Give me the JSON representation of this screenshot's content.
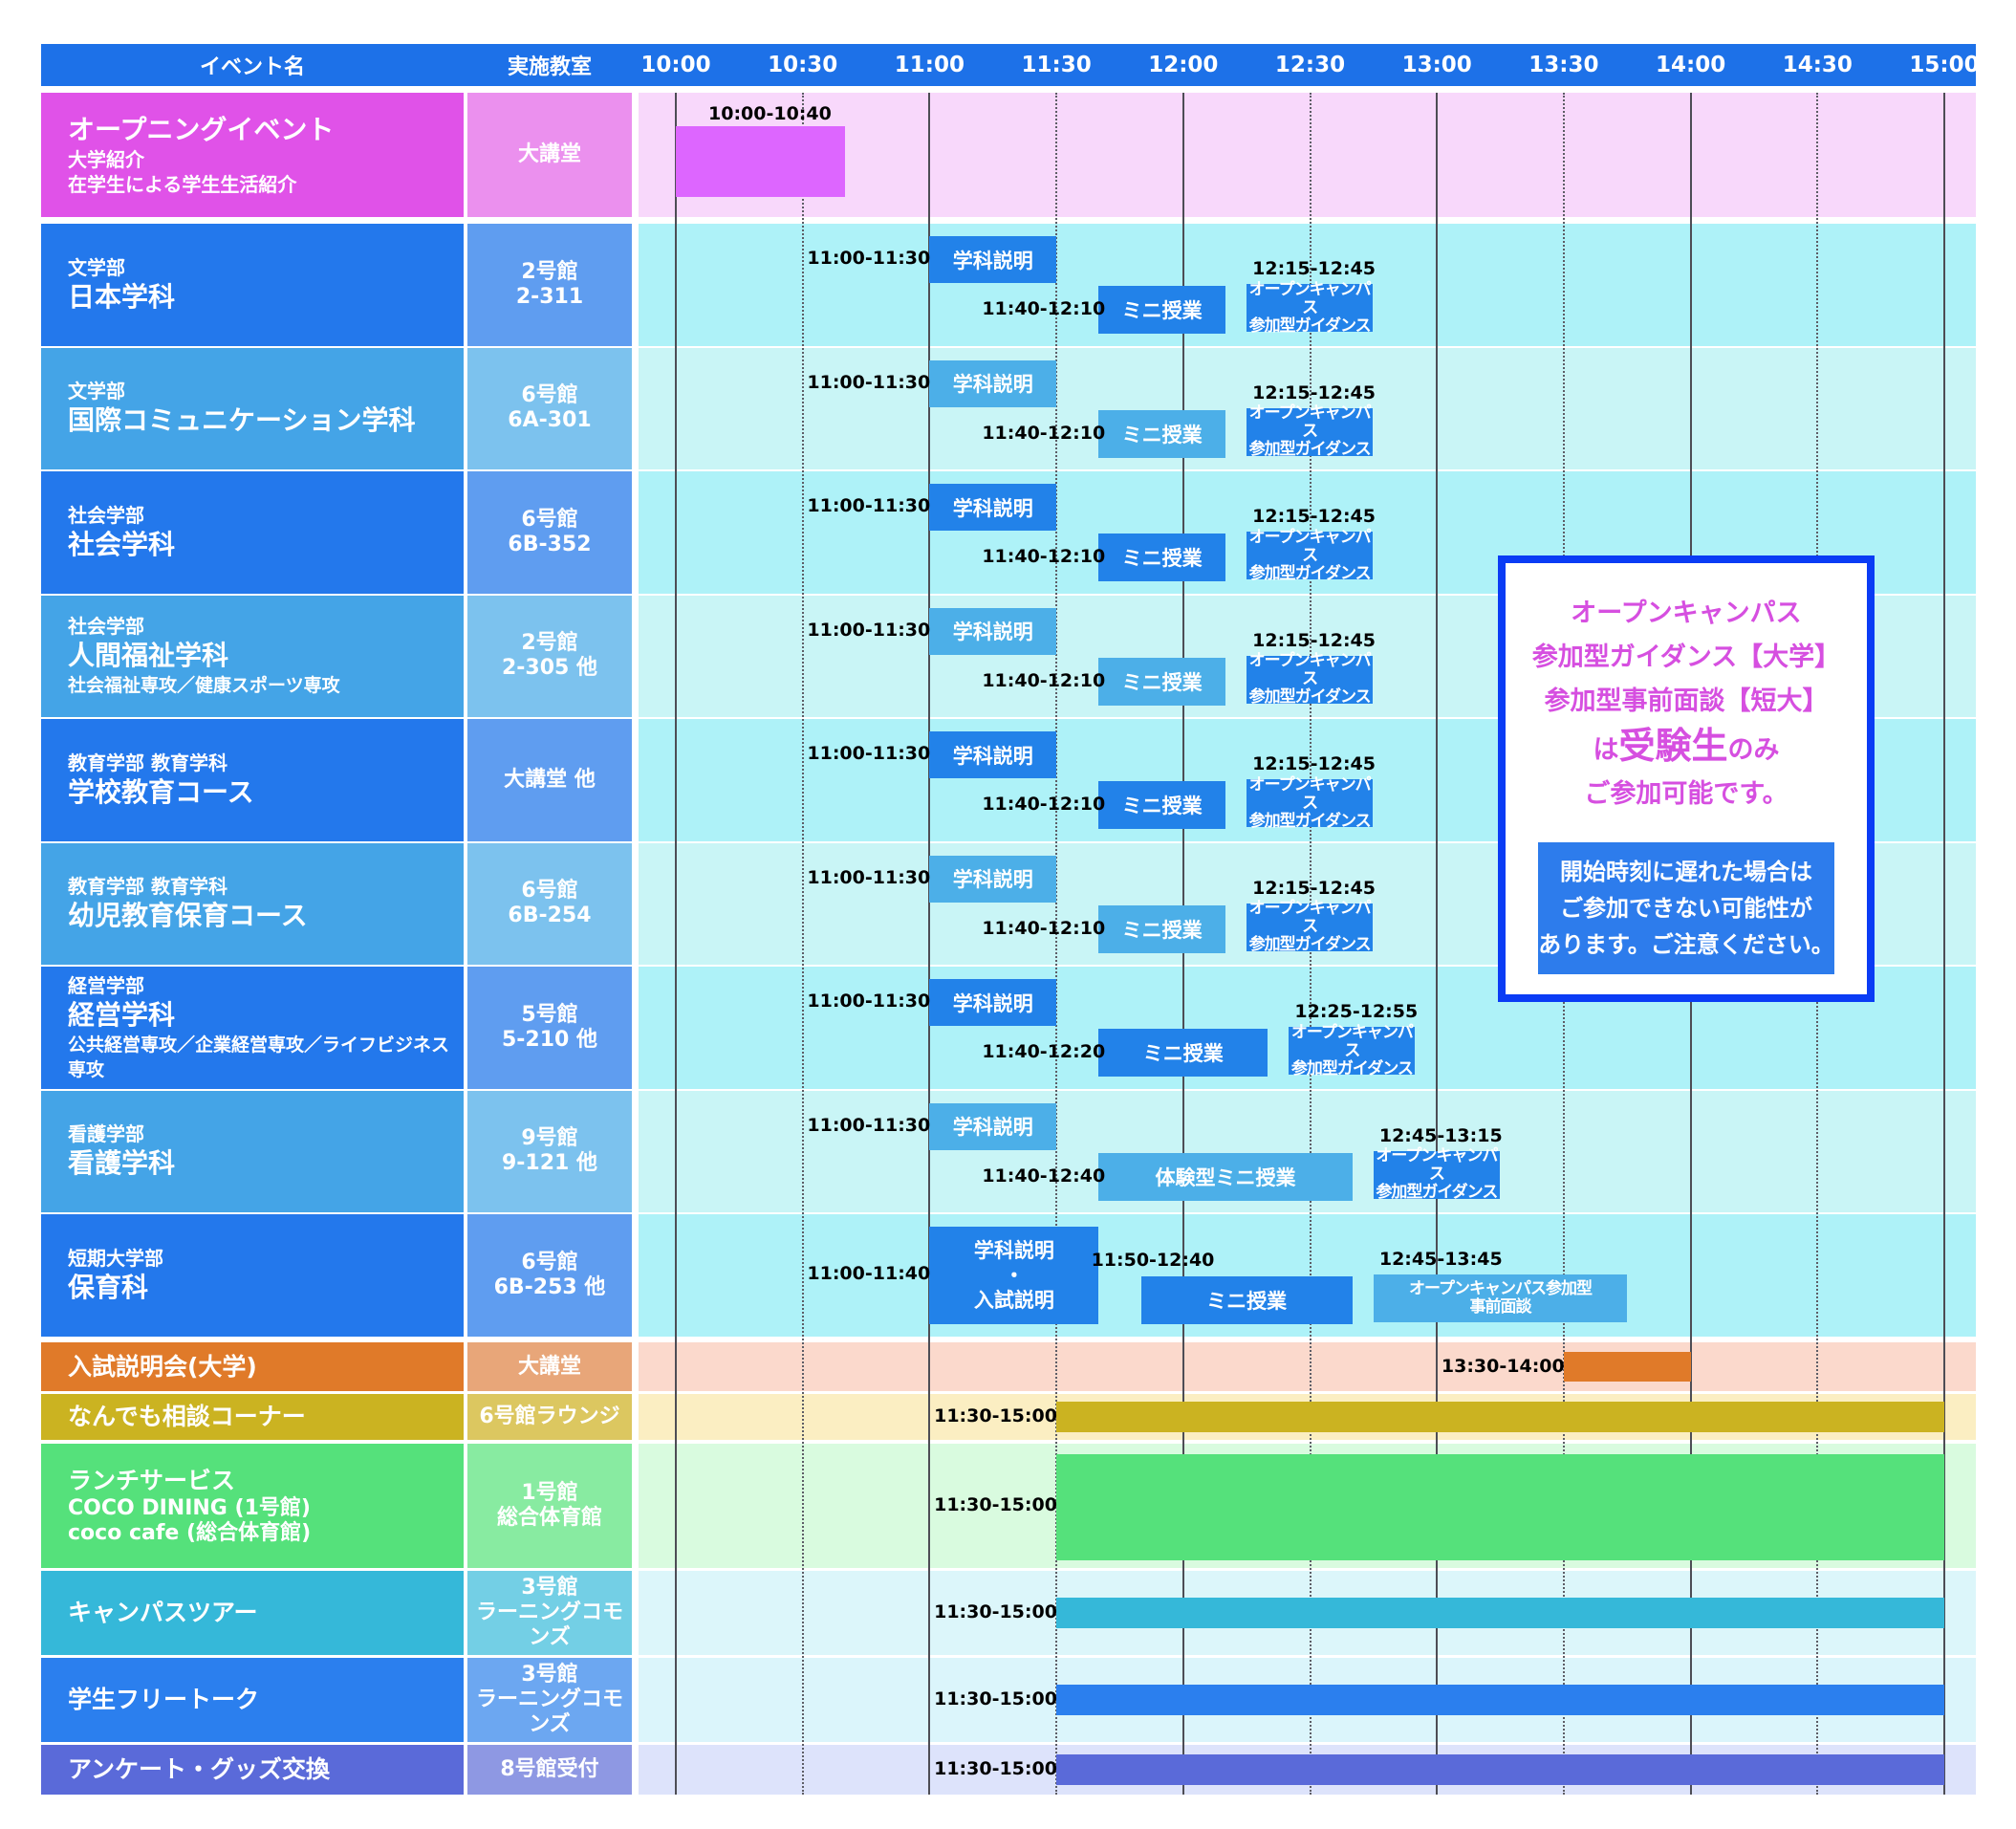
{
  "header": {
    "event_col": "イベント名",
    "room_col": "実施教室",
    "times": [
      "10:00",
      "10:30",
      "11:00",
      "11:30",
      "12:00",
      "12:30",
      "13:00",
      "13:30",
      "14:00",
      "14:30",
      "15:00"
    ]
  },
  "opening": {
    "title": "オープニングイベント",
    "sub1": "大学紹介",
    "sub2": "在学生による学生生活紹介",
    "room": "大講堂",
    "time_label": "10:00-10:40"
  },
  "labels": {
    "dept_explain": "学科説明",
    "mini_class": "ミニ授業",
    "guide_line1": "オープンキャンパス",
    "guide_line2": "参加型ガイダンス"
  },
  "departments": [
    {
      "faculty": "文学部",
      "name": "日本学科",
      "extra": "",
      "room1": "2号館",
      "room2": "2-311",
      "t1": "11:00-11:30",
      "t2": "11:40-12:10",
      "t3": "12:15-12:45"
    },
    {
      "faculty": "文学部",
      "name": "国際コミュニケーション学科",
      "extra": "",
      "room1": "6号館",
      "room2": "6A-301",
      "t1": "11:00-11:30",
      "t2": "11:40-12:10",
      "t3": "12:15-12:45"
    },
    {
      "faculty": "社会学部",
      "name": "社会学科",
      "extra": "",
      "room1": "6号館",
      "room2": "6B-352",
      "t1": "11:00-11:30",
      "t2": "11:40-12:10",
      "t3": "12:15-12:45"
    },
    {
      "faculty": "社会学部",
      "name": "人間福祉学科",
      "extra": "社会福祉専攻／健康スポーツ専攻",
      "room1": "2号館",
      "room2": "2-305 他",
      "t1": "11:00-11:30",
      "t2": "11:40-12:10",
      "t3": "12:15-12:45"
    },
    {
      "faculty": "教育学部 教育学科",
      "name": "学校教育コース",
      "extra": "",
      "room1": "大講堂 他",
      "room2": "",
      "t1": "11:00-11:30",
      "t2": "11:40-12:10",
      "t3": "12:15-12:45"
    },
    {
      "faculty": "教育学部 教育学科",
      "name": "幼児教育保育コース",
      "extra": "",
      "room1": "6号館",
      "room2": "6B-254",
      "t1": "11:00-11:30",
      "t2": "11:40-12:10",
      "t3": "12:15-12:45"
    },
    {
      "faculty": "経営学部",
      "name": "経営学科",
      "extra": "公共経営専攻／企業経営専攻／ライフビジネス専攻",
      "room1": "5号館",
      "room2": "5-210 他",
      "t1": "11:00-11:30",
      "t2": "11:40-12:20",
      "t3": "12:25-12:55"
    },
    {
      "faculty": "看護学部",
      "name": "看護学科",
      "extra": "",
      "room1": "9号館",
      "room2": "9-121 他",
      "t1": "11:00-11:30",
      "t2": "11:40-12:40",
      "t3": "12:45-13:15",
      "mini_label": "体験型ミニ授業"
    },
    {
      "faculty": "短期大学部",
      "name": "保育科",
      "extra": "",
      "room1": "6号館",
      "room2": "6B-253 他",
      "t1": "11:00-11:40",
      "t2": "11:50-12:40",
      "t3": "12:45-13:45",
      "explain1": "学科説明",
      "explain_dot": "・",
      "explain2": "入試説明",
      "guide_short_1": "オープンキャンパス参加型",
      "guide_short_2": "事前面談"
    }
  ],
  "lower_rows": [
    {
      "name": "入試説明会(大学)",
      "room": "大講堂",
      "time": "13:30-14:00"
    },
    {
      "name": "なんでも相談コーナー",
      "room": "6号館ラウンジ",
      "time": "11:30-15:00"
    },
    {
      "name": "ランチサービス",
      "sub1": "COCO DINING (1号館)",
      "sub2": "coco cafe (総合体育館)",
      "room1": "1号館",
      "room2": "総合体育館",
      "time": "11:30-15:00"
    },
    {
      "name": "キャンパスツアー",
      "room1": "3号館",
      "room2": "ラーニングコモンズ",
      "time": "11:30-15:00"
    },
    {
      "name": "学生フリートーク",
      "room1": "3号館",
      "room2": "ラーニングコモンズ",
      "time": "11:30-15:00"
    },
    {
      "name": "アンケート・グッズ交換",
      "room": "8号館受付",
      "time": "11:30-15:00"
    }
  ],
  "notice": {
    "line1": "オープンキャンパス",
    "line2": "参加型ガイダンス【大学】",
    "line3": "参加型事前面談【短大】",
    "line4a": "は",
    "line4b": "受験生",
    "line4c": "のみ",
    "line5": "ご参加可能です。",
    "box1": "開始時刻に遅れた場合は",
    "box2": "ご参加できない可能性が",
    "box3": "あります。ご注意ください。"
  },
  "colors": {
    "header": "#1d71e8",
    "opening_name": "#e052e8",
    "opening_room": "#eb90ee",
    "opening_bg": "#f8d8fb",
    "opening_bar": "#dd66ff",
    "dept_dark": "#2378ec",
    "dept_light": "#44a4e7",
    "dark_block": "#2282e9",
    "light_block": "#4cafe8",
    "exam": "#e07a29",
    "consult": "#cbb321",
    "lunch": "#55e17b",
    "tour": "#35b8d9",
    "freetalk": "#2b7fee",
    "survey": "#5a6ad9",
    "notice_border": "#0a3cf5",
    "notice_text": "#d64fe0"
  }
}
